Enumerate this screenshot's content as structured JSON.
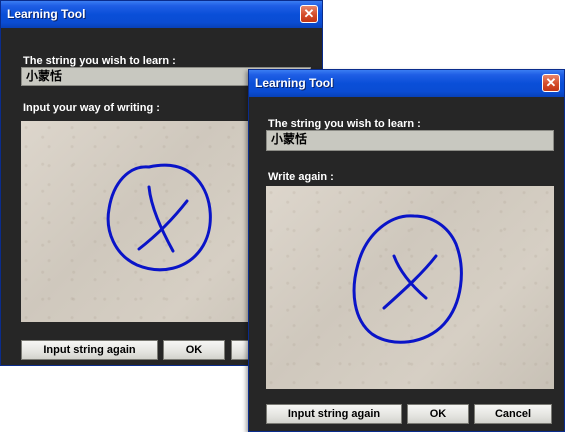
{
  "back_window": {
    "title": "Learning Tool",
    "close_symbol": "✕",
    "string_label": "The string you wish to learn :",
    "string_value": "小蒙恬",
    "input_label": "Input your way of writing :",
    "buttons": {
      "input_again": "Input string again",
      "ok": "OK"
    }
  },
  "front_window": {
    "title": "Learning Tool",
    "close_symbol": "✕",
    "string_label": "The string you wish to learn :",
    "string_value": "小蒙恬",
    "input_label": "Write again :",
    "buttons": {
      "input_again": "Input string again",
      "ok": "OK",
      "cancel": "Cancel"
    }
  },
  "ink_color": "#0a14c8",
  "icons": [
    "close-icon"
  ]
}
